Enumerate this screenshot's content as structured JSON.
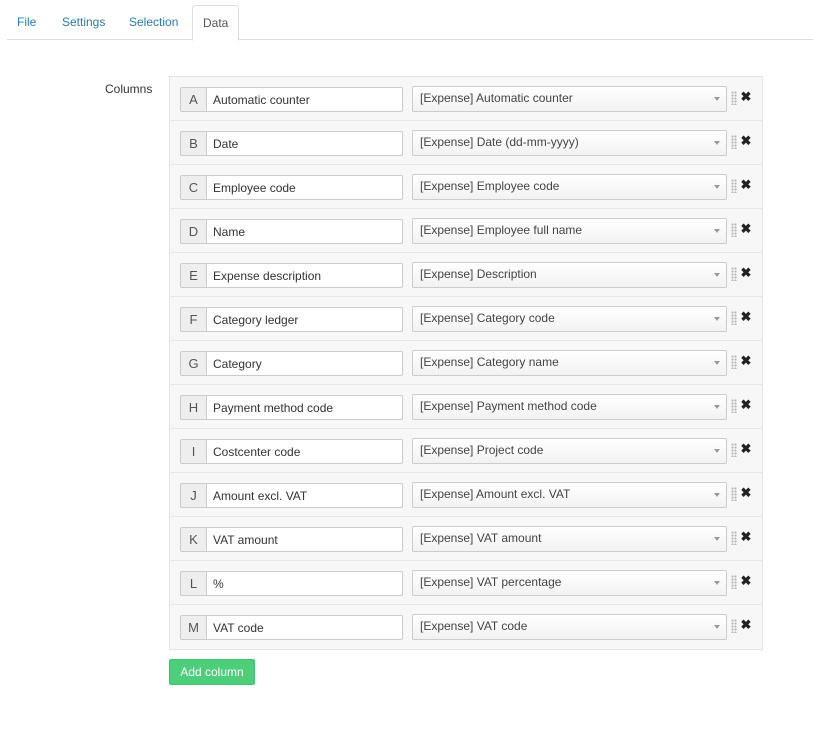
{
  "tabs": [
    {
      "label": "File",
      "active": false
    },
    {
      "label": "Settings",
      "active": false
    },
    {
      "label": "Selection",
      "active": false
    },
    {
      "label": "Data",
      "active": true
    }
  ],
  "columns_label": "Columns",
  "columns": [
    {
      "letter": "A",
      "name": "Automatic counter",
      "mapping": "[Expense] Automatic counter"
    },
    {
      "letter": "B",
      "name": "Date",
      "mapping": "[Expense] Date (dd-mm-yyyy)"
    },
    {
      "letter": "C",
      "name": "Employee code",
      "mapping": "[Expense] Employee code"
    },
    {
      "letter": "D",
      "name": "Name",
      "mapping": "[Expense] Employee full name"
    },
    {
      "letter": "E",
      "name": "Expense description",
      "mapping": "[Expense] Description"
    },
    {
      "letter": "F",
      "name": "Category ledger",
      "mapping": "[Expense] Category code"
    },
    {
      "letter": "G",
      "name": "Category",
      "mapping": "[Expense] Category name"
    },
    {
      "letter": "H",
      "name": "Payment method code",
      "mapping": "[Expense] Payment method code"
    },
    {
      "letter": "I",
      "name": "Costcenter code",
      "mapping": "[Expense] Project code"
    },
    {
      "letter": "J",
      "name": "Amount excl. VAT",
      "mapping": "[Expense] Amount excl. VAT"
    },
    {
      "letter": "K",
      "name": "VAT amount",
      "mapping": "[Expense] VAT amount"
    },
    {
      "letter": "L",
      "name": "%",
      "mapping": "[Expense] VAT percentage"
    },
    {
      "letter": "M",
      "name": "VAT code",
      "mapping": "[Expense] VAT code"
    }
  ],
  "icons": {
    "remove": "close-icon",
    "drag": "drag-handle-icon",
    "dropdown": "chevron-down-icon"
  },
  "add_button_label": "Add column",
  "colors": {
    "link": "#2a7ab0",
    "add_button": "#4cce7a"
  }
}
